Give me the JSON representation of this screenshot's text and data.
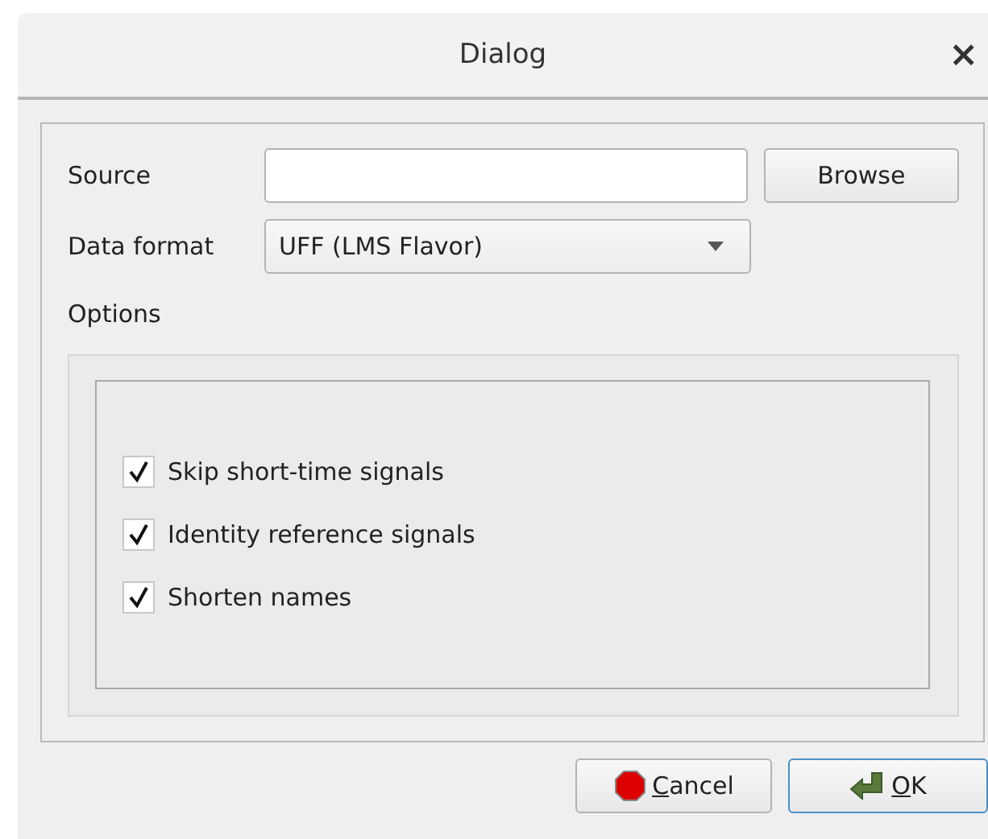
{
  "window": {
    "title": "Dialog",
    "close": "×"
  },
  "source": {
    "label": "Source",
    "browse": "Browse"
  },
  "data_format": {
    "label": "Data format",
    "value": "UFF (LMS Flavor)"
  },
  "options": {
    "label": "Options",
    "items": [
      {
        "label": "Skip short-time signals",
        "checked": true
      },
      {
        "label": "Identity reference signals",
        "checked": true
      },
      {
        "label": "Shorten names",
        "checked": true
      }
    ]
  },
  "buttons": [
    {
      "kind": "cancel",
      "label": "Cancel",
      "default": false
    },
    {
      "kind": "ok",
      "label": "OK",
      "default": true
    }
  ]
}
